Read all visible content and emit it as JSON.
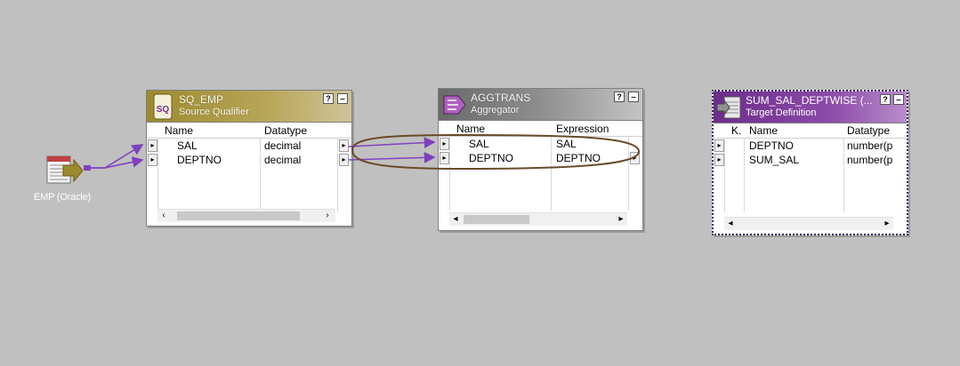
{
  "source": {
    "label": "EMP (Oracle)",
    "icon": "database-source-icon"
  },
  "source_qualifier": {
    "name": "SQ_EMP",
    "type": "Source Qualifier",
    "icon": "source-qualifier-icon",
    "columns": [
      "Name",
      "Datatype"
    ],
    "ports": [
      {
        "name": "SAL",
        "datatype": "decimal"
      },
      {
        "name": "DEPTNO",
        "datatype": "decimal"
      }
    ],
    "buttons": {
      "help": "?",
      "minimize": "‒"
    }
  },
  "aggregator": {
    "name": "AGGTRANS",
    "type": "Aggregator",
    "icon": "aggregator-icon",
    "columns": [
      "Name",
      "Expression"
    ],
    "ports": [
      {
        "name": "SAL",
        "expression": "SAL"
      },
      {
        "name": "DEPTNO",
        "expression": "DEPTNO"
      }
    ],
    "buttons": {
      "help": "?",
      "minimize": "‒"
    }
  },
  "target": {
    "name": "SUM_SAL_DEPTWISE (...",
    "type": "Target Definition",
    "icon": "target-definition-icon",
    "columns": [
      "K.",
      "Name",
      "Datatype"
    ],
    "ports": [
      {
        "name": "DEPTNO",
        "datatype": "number(p"
      },
      {
        "name": "SUM_SAL",
        "datatype": "number(p"
      }
    ],
    "buttons": {
      "help": "?",
      "minimize": "‒"
    }
  },
  "colors": {
    "canvas": "#c0c0c0",
    "link": "#8040c0",
    "highlight_ellipse": "#6b4a2a",
    "source_qualifier_header": "#9c8a2e",
    "aggregator_header": "#7a7a7a",
    "target_header": "#6d2c8a"
  }
}
